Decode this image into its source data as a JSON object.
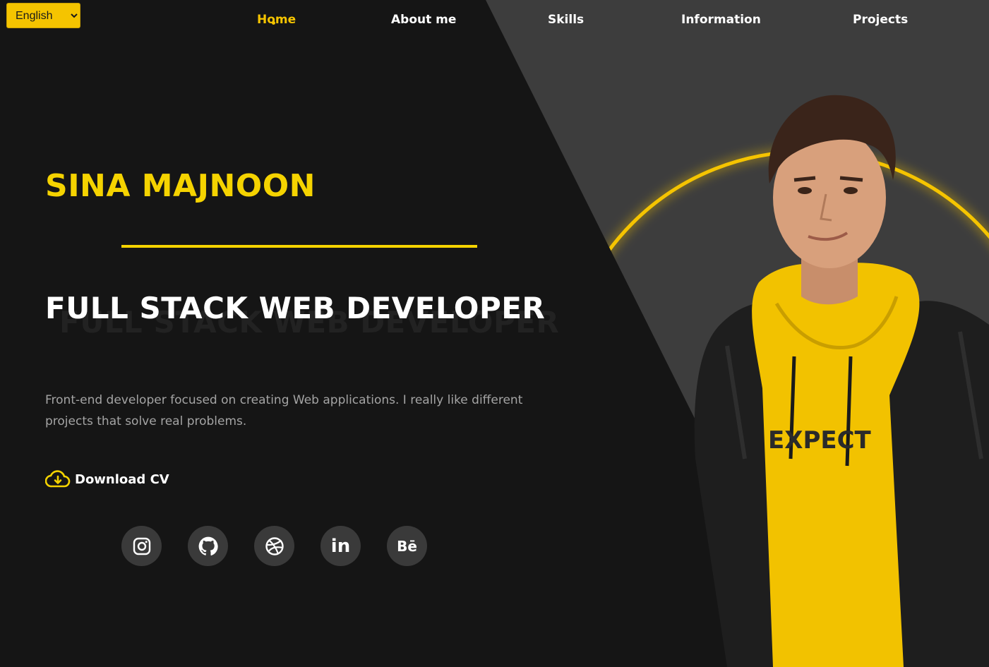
{
  "language": {
    "selected": "English",
    "options": [
      "English"
    ]
  },
  "nav": {
    "items": [
      {
        "label": "Home",
        "active": true
      },
      {
        "label": "About me",
        "active": false
      },
      {
        "label": "Skills",
        "active": false
      },
      {
        "label": "Information",
        "active": false
      },
      {
        "label": "Projects",
        "active": false
      }
    ]
  },
  "hero": {
    "name": "SINA MAJNOON",
    "role": "FULL STACK WEB DEVELOPER",
    "bio": "Front-end developer focused on creating Web applications. I really like different projects that solve real problems.",
    "download_label": "Download CV",
    "shirt_text": "EXPECT"
  },
  "socials": [
    {
      "name": "instagram-icon",
      "glyph": ""
    },
    {
      "name": "github-icon",
      "glyph": ""
    },
    {
      "name": "dribbble-icon",
      "glyph": ""
    },
    {
      "name": "linkedin-icon",
      "glyph": "in"
    },
    {
      "name": "behance-icon",
      "glyph": "Bē"
    }
  ],
  "colors": {
    "accent": "#f5d300",
    "background": "#151515",
    "panel": "#3d3d3d"
  }
}
